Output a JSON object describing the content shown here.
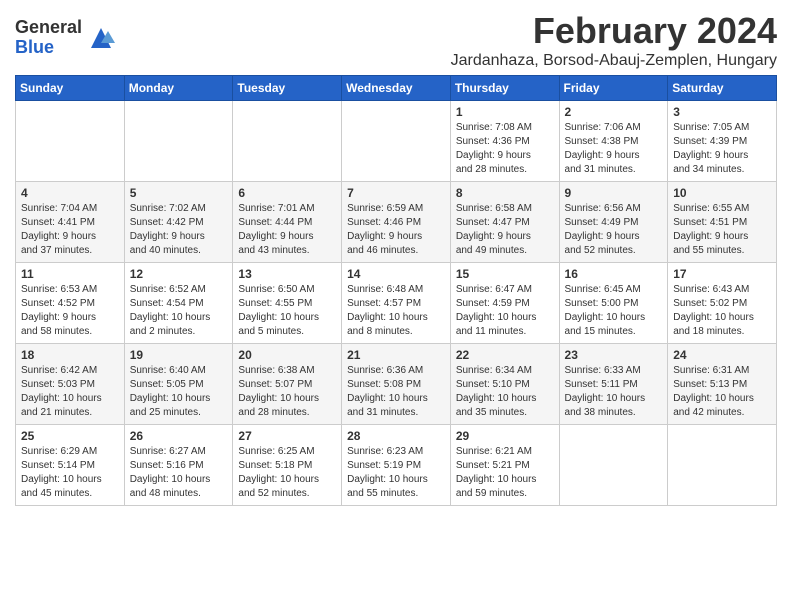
{
  "header": {
    "logo_general": "General",
    "logo_blue": "Blue",
    "title": "February 2024",
    "subtitle": "Jardanhaza, Borsod-Abauj-Zemplen, Hungary"
  },
  "weekdays": [
    "Sunday",
    "Monday",
    "Tuesday",
    "Wednesday",
    "Thursday",
    "Friday",
    "Saturday"
  ],
  "weeks": [
    [
      {
        "day": "",
        "info": ""
      },
      {
        "day": "",
        "info": ""
      },
      {
        "day": "",
        "info": ""
      },
      {
        "day": "",
        "info": ""
      },
      {
        "day": "1",
        "info": "Sunrise: 7:08 AM\nSunset: 4:36 PM\nDaylight: 9 hours\nand 28 minutes."
      },
      {
        "day": "2",
        "info": "Sunrise: 7:06 AM\nSunset: 4:38 PM\nDaylight: 9 hours\nand 31 minutes."
      },
      {
        "day": "3",
        "info": "Sunrise: 7:05 AM\nSunset: 4:39 PM\nDaylight: 9 hours\nand 34 minutes."
      }
    ],
    [
      {
        "day": "4",
        "info": "Sunrise: 7:04 AM\nSunset: 4:41 PM\nDaylight: 9 hours\nand 37 minutes."
      },
      {
        "day": "5",
        "info": "Sunrise: 7:02 AM\nSunset: 4:42 PM\nDaylight: 9 hours\nand 40 minutes."
      },
      {
        "day": "6",
        "info": "Sunrise: 7:01 AM\nSunset: 4:44 PM\nDaylight: 9 hours\nand 43 minutes."
      },
      {
        "day": "7",
        "info": "Sunrise: 6:59 AM\nSunset: 4:46 PM\nDaylight: 9 hours\nand 46 minutes."
      },
      {
        "day": "8",
        "info": "Sunrise: 6:58 AM\nSunset: 4:47 PM\nDaylight: 9 hours\nand 49 minutes."
      },
      {
        "day": "9",
        "info": "Sunrise: 6:56 AM\nSunset: 4:49 PM\nDaylight: 9 hours\nand 52 minutes."
      },
      {
        "day": "10",
        "info": "Sunrise: 6:55 AM\nSunset: 4:51 PM\nDaylight: 9 hours\nand 55 minutes."
      }
    ],
    [
      {
        "day": "11",
        "info": "Sunrise: 6:53 AM\nSunset: 4:52 PM\nDaylight: 9 hours\nand 58 minutes."
      },
      {
        "day": "12",
        "info": "Sunrise: 6:52 AM\nSunset: 4:54 PM\nDaylight: 10 hours\nand 2 minutes."
      },
      {
        "day": "13",
        "info": "Sunrise: 6:50 AM\nSunset: 4:55 PM\nDaylight: 10 hours\nand 5 minutes."
      },
      {
        "day": "14",
        "info": "Sunrise: 6:48 AM\nSunset: 4:57 PM\nDaylight: 10 hours\nand 8 minutes."
      },
      {
        "day": "15",
        "info": "Sunrise: 6:47 AM\nSunset: 4:59 PM\nDaylight: 10 hours\nand 11 minutes."
      },
      {
        "day": "16",
        "info": "Sunrise: 6:45 AM\nSunset: 5:00 PM\nDaylight: 10 hours\nand 15 minutes."
      },
      {
        "day": "17",
        "info": "Sunrise: 6:43 AM\nSunset: 5:02 PM\nDaylight: 10 hours\nand 18 minutes."
      }
    ],
    [
      {
        "day": "18",
        "info": "Sunrise: 6:42 AM\nSunset: 5:03 PM\nDaylight: 10 hours\nand 21 minutes."
      },
      {
        "day": "19",
        "info": "Sunrise: 6:40 AM\nSunset: 5:05 PM\nDaylight: 10 hours\nand 25 minutes."
      },
      {
        "day": "20",
        "info": "Sunrise: 6:38 AM\nSunset: 5:07 PM\nDaylight: 10 hours\nand 28 minutes."
      },
      {
        "day": "21",
        "info": "Sunrise: 6:36 AM\nSunset: 5:08 PM\nDaylight: 10 hours\nand 31 minutes."
      },
      {
        "day": "22",
        "info": "Sunrise: 6:34 AM\nSunset: 5:10 PM\nDaylight: 10 hours\nand 35 minutes."
      },
      {
        "day": "23",
        "info": "Sunrise: 6:33 AM\nSunset: 5:11 PM\nDaylight: 10 hours\nand 38 minutes."
      },
      {
        "day": "24",
        "info": "Sunrise: 6:31 AM\nSunset: 5:13 PM\nDaylight: 10 hours\nand 42 minutes."
      }
    ],
    [
      {
        "day": "25",
        "info": "Sunrise: 6:29 AM\nSunset: 5:14 PM\nDaylight: 10 hours\nand 45 minutes."
      },
      {
        "day": "26",
        "info": "Sunrise: 6:27 AM\nSunset: 5:16 PM\nDaylight: 10 hours\nand 48 minutes."
      },
      {
        "day": "27",
        "info": "Sunrise: 6:25 AM\nSunset: 5:18 PM\nDaylight: 10 hours\nand 52 minutes."
      },
      {
        "day": "28",
        "info": "Sunrise: 6:23 AM\nSunset: 5:19 PM\nDaylight: 10 hours\nand 55 minutes."
      },
      {
        "day": "29",
        "info": "Sunrise: 6:21 AM\nSunset: 5:21 PM\nDaylight: 10 hours\nand 59 minutes."
      },
      {
        "day": "",
        "info": ""
      },
      {
        "day": "",
        "info": ""
      }
    ]
  ]
}
